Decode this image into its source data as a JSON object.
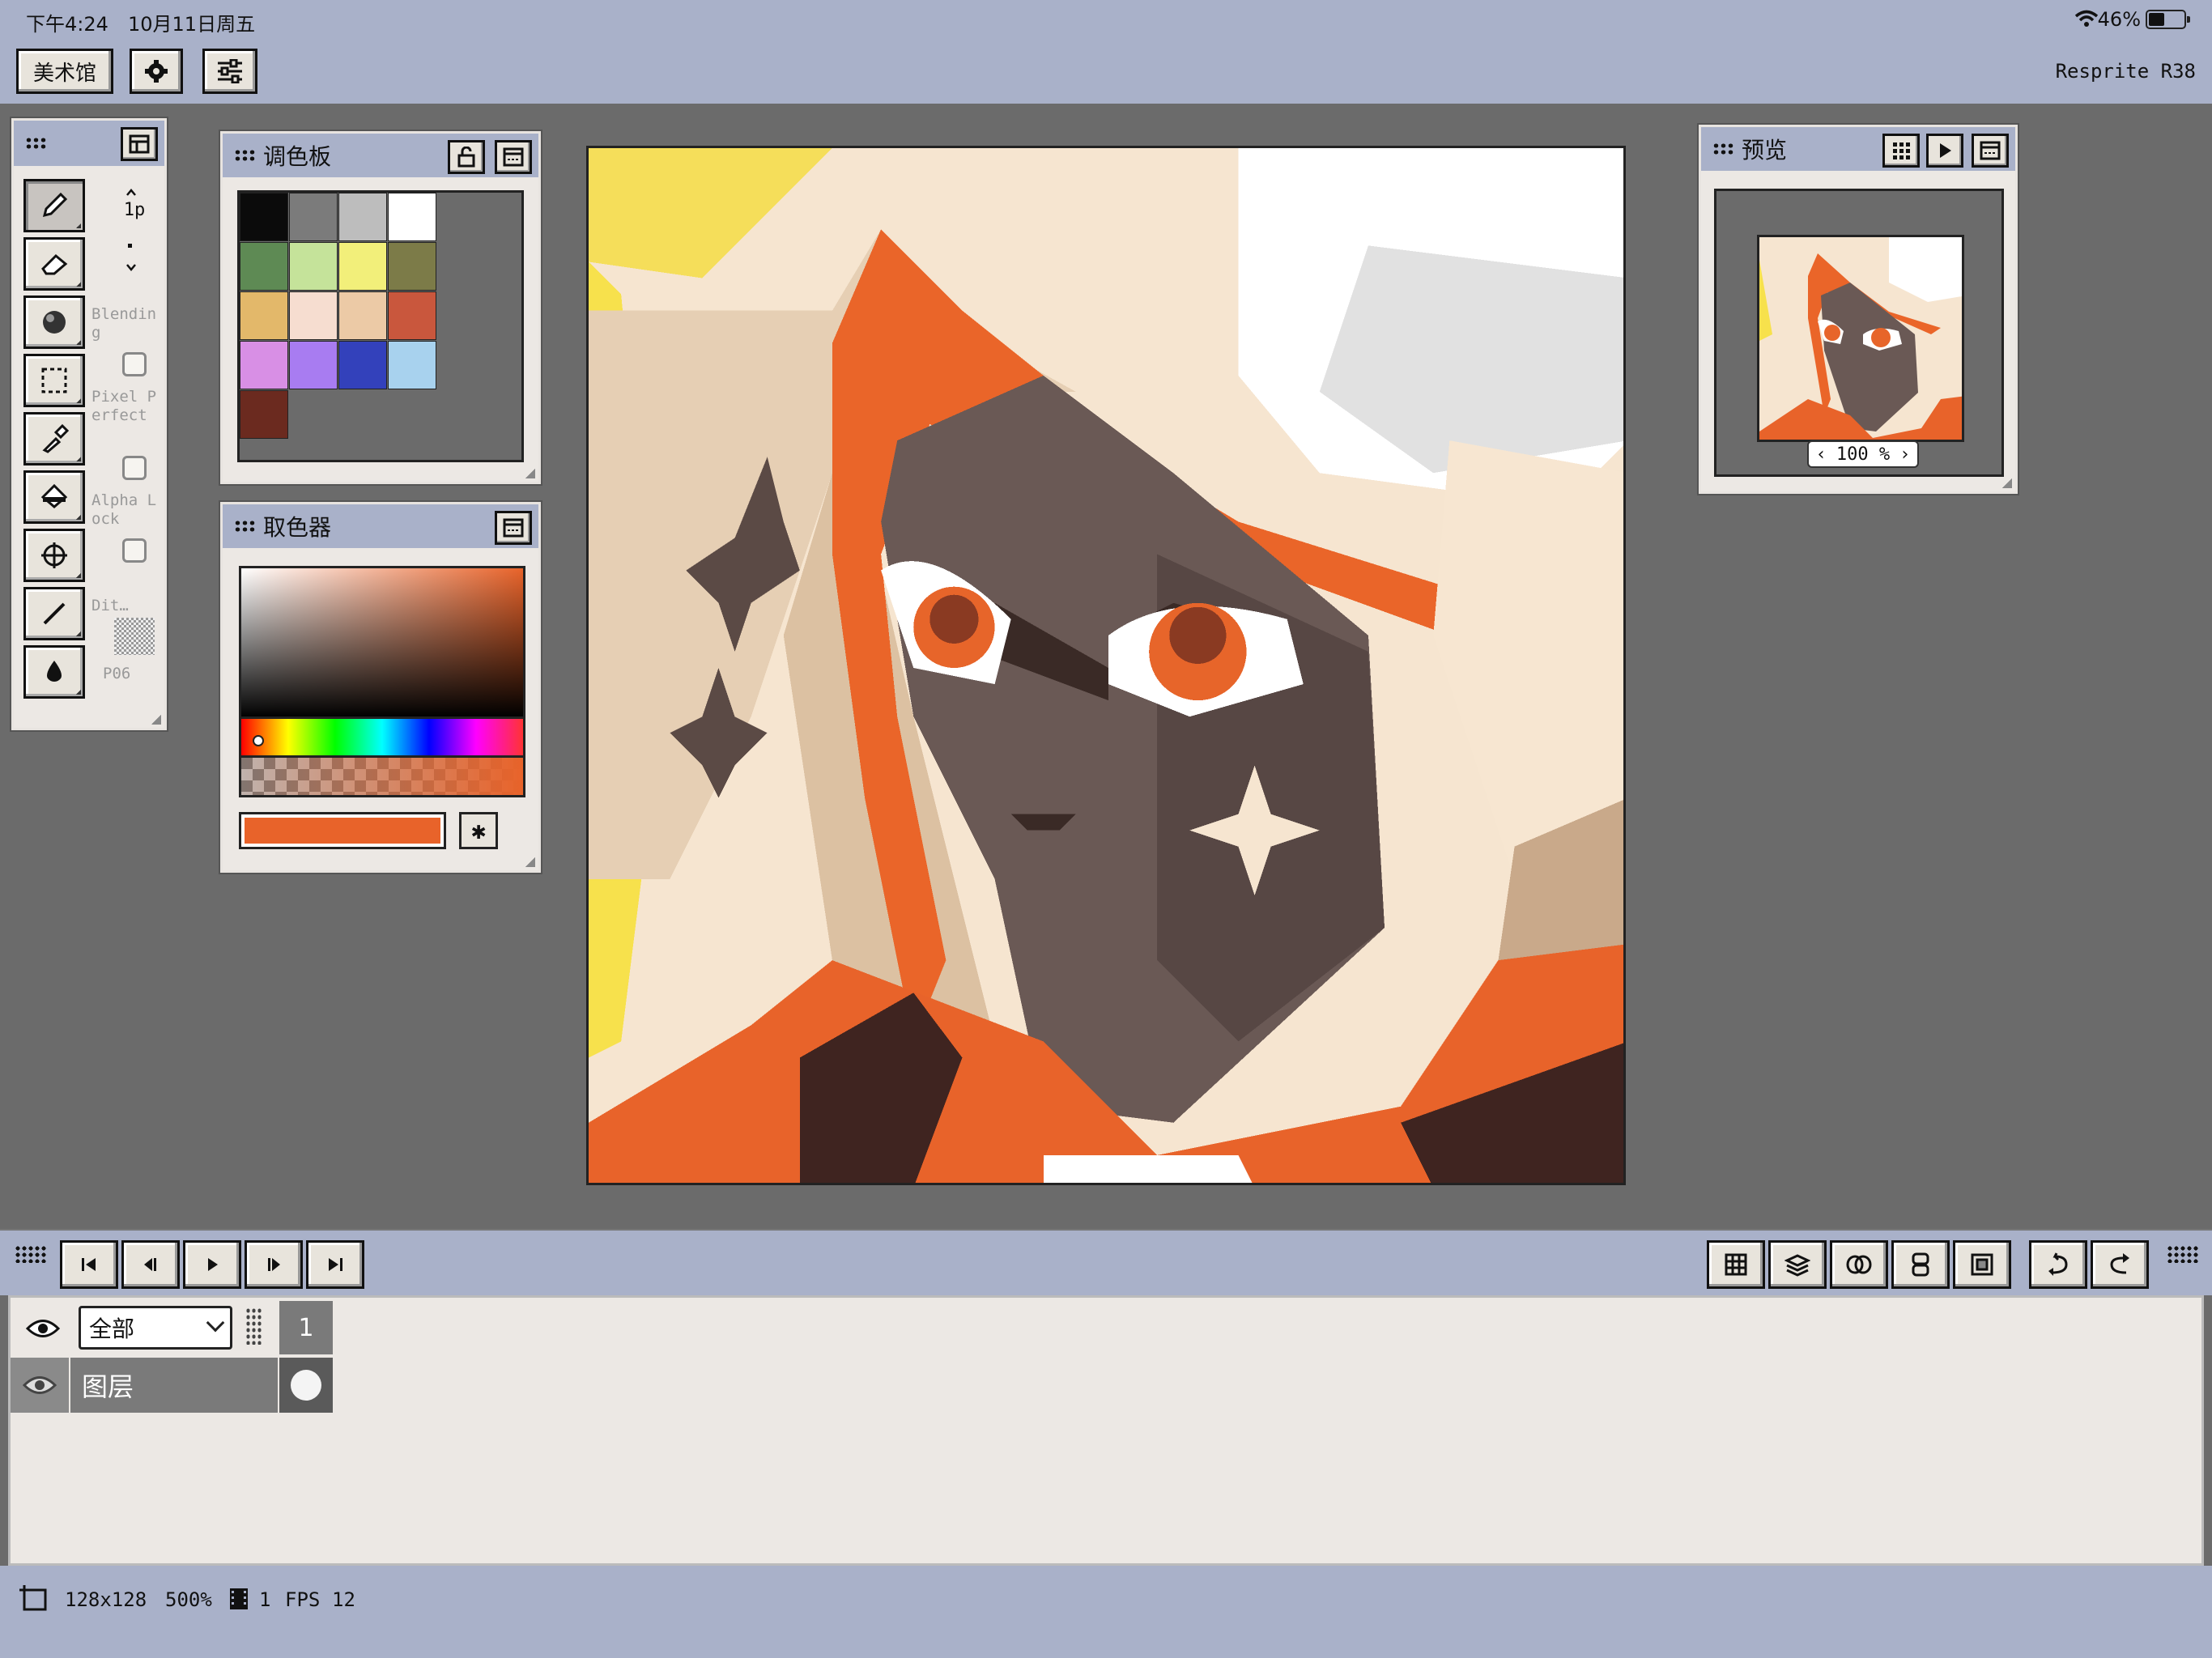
{
  "status_bar": {
    "time": "下午4:24",
    "date": "10月11日周五",
    "battery_percent": "46%",
    "battery_level": 0.46,
    "icons": [
      "wifi-icon",
      "battery-icon"
    ]
  },
  "toolbar": {
    "gallery_label": "美术馆",
    "settings_icon": "gear-icon",
    "adjust_icon": "sliders-icon",
    "app_name": "Resprite R38"
  },
  "tools_panel": {
    "tools": [
      "pencil-icon",
      "eraser-icon",
      "shading-ball-icon",
      "selection-icon",
      "eyedropper-icon",
      "fill-bucket-icon",
      "move-icon",
      "line-icon",
      "ink-drop-icon"
    ],
    "brush_size": "1p",
    "options": {
      "blending": "Blending",
      "pixel_perfect": "Pixel Perfect",
      "alpha_lock": "Alpha Lock",
      "dither": "Dit…",
      "dither_pattern": "P06"
    }
  },
  "palette": {
    "title": "调色板",
    "colors": [
      "#0b0b0b",
      "#7b7b7b",
      "#bdbdbd",
      "#ffffff",
      "#5e8a54",
      "#c5e39a",
      "#f2ef7a",
      "#7c7b48",
      "#e3b86a",
      "#f6ddd0",
      "#eccaa6",
      "#c9573d",
      "#d88fe5",
      "#a87cf1",
      "#3341bb",
      "#a8d2ee",
      "#6b2a1f"
    ]
  },
  "color_picker": {
    "title": "取色器",
    "current_color": "#e8632a",
    "hex_button": "✱"
  },
  "preview": {
    "title": "预览",
    "zoom": "100 %"
  },
  "timeline": {
    "frame_filter": "全部",
    "frame_number": "1",
    "layer_name": "图层",
    "playback_icons": [
      "first-frame-icon",
      "prev-frame-icon",
      "play-icon",
      "next-frame-icon",
      "last-frame-icon"
    ],
    "right_icons": [
      "grid-icon",
      "layers-icon",
      "onion-skin-icon",
      "frame-link-icon",
      "crop-icon",
      "undo-icon",
      "redo-icon"
    ]
  },
  "bottom_status": {
    "size": "128x128",
    "zoom": "500%",
    "frames": "1",
    "fps_label": "FPS",
    "fps": "12"
  }
}
